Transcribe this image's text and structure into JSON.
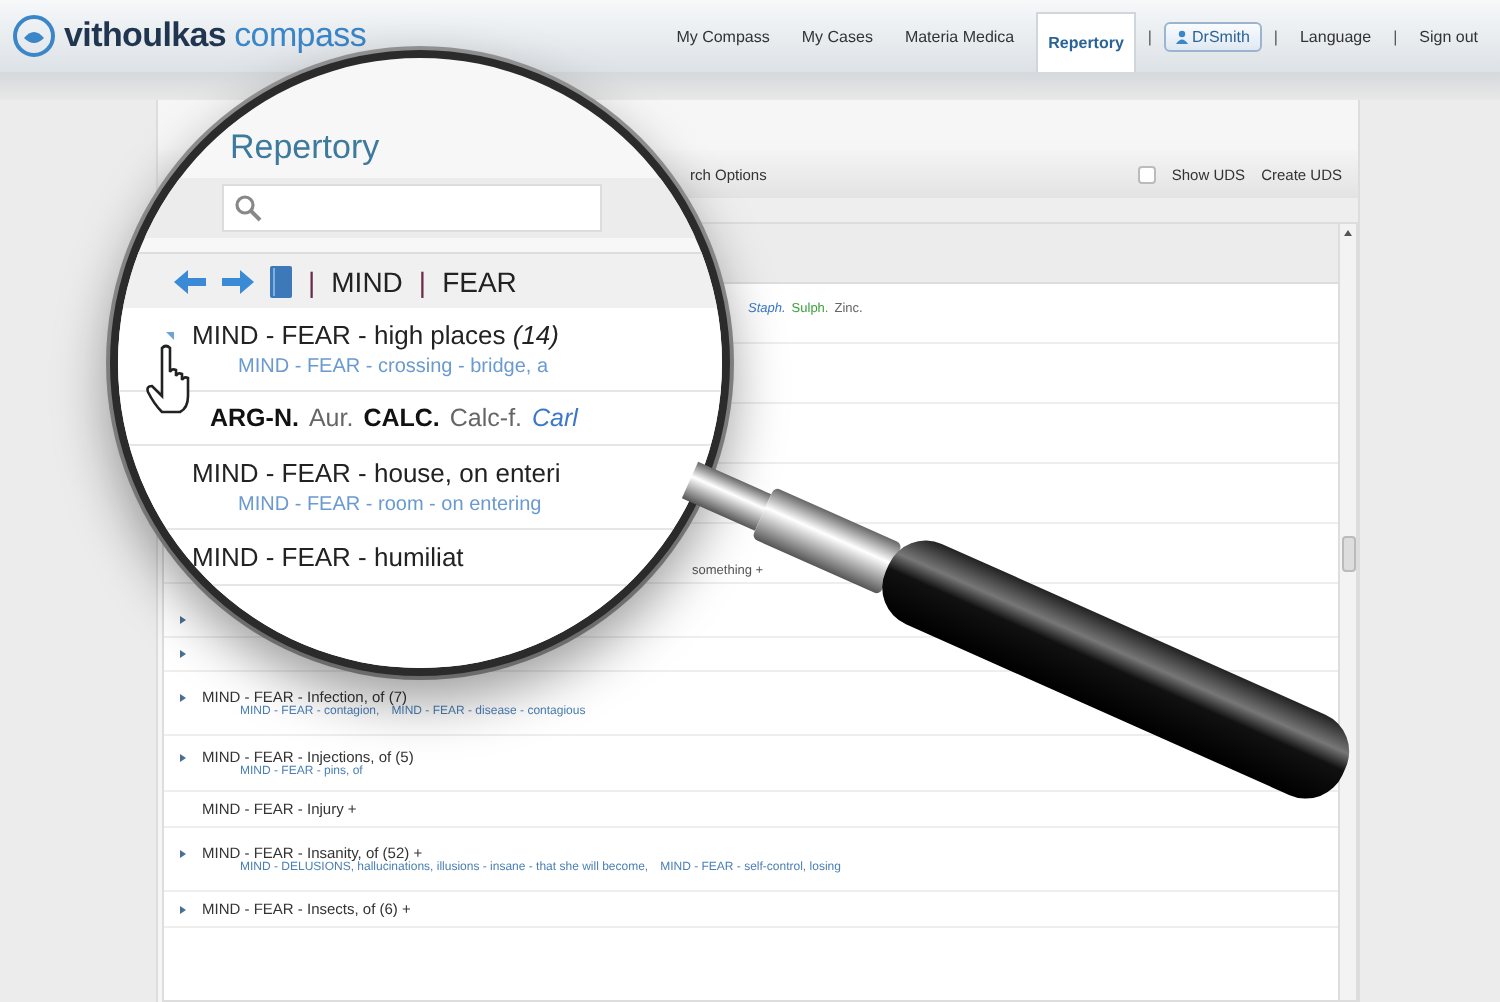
{
  "header": {
    "logo": {
      "part_1": "vithoulkas",
      "part_2": "compass"
    },
    "nav": [
      {
        "kind": "link",
        "label": "My Compass",
        "selected": false
      },
      {
        "kind": "link",
        "label": "My Cases",
        "selected": false
      },
      {
        "kind": "link",
        "label": "Materia Medica",
        "selected": false
      },
      {
        "kind": "link",
        "label": "Repertory",
        "selected": true
      },
      {
        "kind": "separator",
        "label": "|"
      },
      {
        "kind": "user",
        "label": "DrSmith"
      },
      {
        "kind": "separator",
        "label": "|"
      },
      {
        "kind": "link",
        "label": "Language",
        "selected": false
      },
      {
        "kind": "separator",
        "label": "|"
      },
      {
        "kind": "link",
        "label": "Sign out",
        "selected": false
      }
    ]
  },
  "toolbar": {
    "search_options": "rch Options",
    "show_uds": {
      "label": "Show UDS",
      "checked": false
    },
    "create_uds": "Create UDS"
  },
  "list": {
    "upper_remedies": [
      {
        "text": "Staph.",
        "kind": "blue"
      },
      {
        "text": "Sulph.",
        "kind": "green"
      },
      {
        "text": "Zinc.",
        "kind": "plain"
      }
    ],
    "upper_note": "something +",
    "rows": [
      {
        "kind": "branch"
      },
      {
        "kind": "branch"
      },
      {
        "kind": "branch",
        "title": "MIND - FEAR - Infection, of (7)",
        "links": [
          "MIND - FEAR - contagion,",
          "MIND - FEAR - disease - contagious"
        ]
      },
      {
        "kind": "branch",
        "title": "MIND - FEAR - Injections, of (5)",
        "links": [
          "MIND - FEAR - pins, of"
        ]
      },
      {
        "kind": "leaf",
        "title": "MIND - FEAR - Injury +"
      },
      {
        "kind": "branch",
        "title": "MIND - FEAR - Insanity, of (52) +",
        "links": [
          "MIND - DELUSIONS, hallucinations, illusions - insane - that she will become,",
          "MIND - FEAR - self-control, losing"
        ]
      },
      {
        "kind": "branch",
        "title": "MIND - FEAR - Insects, of (6) +"
      }
    ]
  },
  "lens": {
    "title": "Repertory",
    "breadcrumb": [
      "|",
      "MIND",
      "|",
      "FEAR"
    ],
    "rows": [
      {
        "kind": "rubric",
        "expanded": true,
        "title": "MIND - FEAR - high places *(14)*",
        "links": [
          "MIND - FEAR - crossing - bridge, a"
        ]
      },
      {
        "kind": "remedies",
        "remedies": [
          {
            "text": "ARG-N.",
            "kind": "bold"
          },
          {
            "text": "Aur.",
            "kind": "plain"
          },
          {
            "text": "CALC.",
            "kind": "bold"
          },
          {
            "text": "Calc-f.",
            "kind": "plain"
          },
          {
            "text": "Carl",
            "kind": "blue"
          }
        ]
      },
      {
        "kind": "rubric",
        "title": "MIND - FEAR - house, on enteri",
        "links": [
          "MIND - FEAR - room - on entering"
        ]
      },
      {
        "kind": "rubric",
        "title": "MIND - FEAR - humiliat"
      }
    ]
  }
}
